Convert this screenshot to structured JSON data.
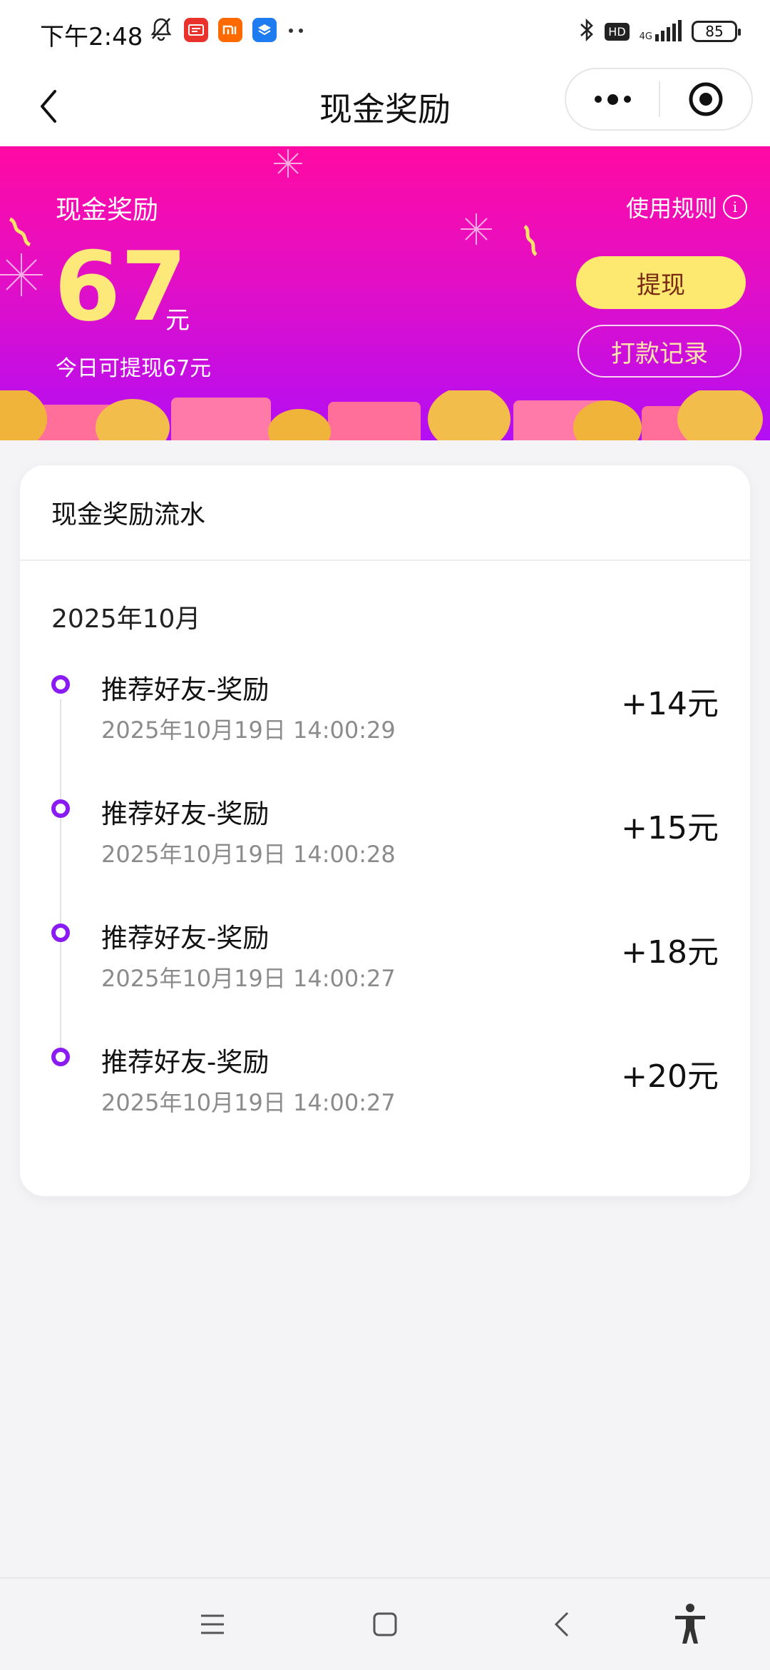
{
  "status_bar": {
    "time": "下午2:48",
    "battery": "85",
    "network": "4G",
    "hd": "HD",
    "icons": [
      "bell-off-icon",
      "news-app-icon",
      "mi-app-icon",
      "ai-app-icon",
      "more-dots-icon",
      "bluetooth-icon",
      "signal-icon",
      "battery-icon"
    ]
  },
  "nav": {
    "title": "现金奖励"
  },
  "banner": {
    "label": "现金奖励",
    "rules": "使用规则",
    "amount": "67",
    "unit": "元",
    "today": "今日可提现67元",
    "withdraw": "提现",
    "records": "打款记录"
  },
  "card": {
    "title": "现金奖励流水",
    "month": "2025年10月",
    "entries": [
      {
        "title": "推荐好友-奖励",
        "time": "2025年10月19日 14:00:29",
        "amount": "+14元"
      },
      {
        "title": "推荐好友-奖励",
        "time": "2025年10月19日 14:00:28",
        "amount": "+15元"
      },
      {
        "title": "推荐好友-奖励",
        "time": "2025年10月19日 14:00:27",
        "amount": "+18元"
      },
      {
        "title": "推荐好友-奖励",
        "time": "2025年10月19日 14:00:27",
        "amount": "+20元"
      }
    ]
  },
  "colors": {
    "banner_top": "#ff0aa3",
    "banner_bottom": "#b30ef5",
    "amount": "#fde87a",
    "withdraw_button": "#fde870",
    "timeline_dot": "#8a1bf2"
  }
}
